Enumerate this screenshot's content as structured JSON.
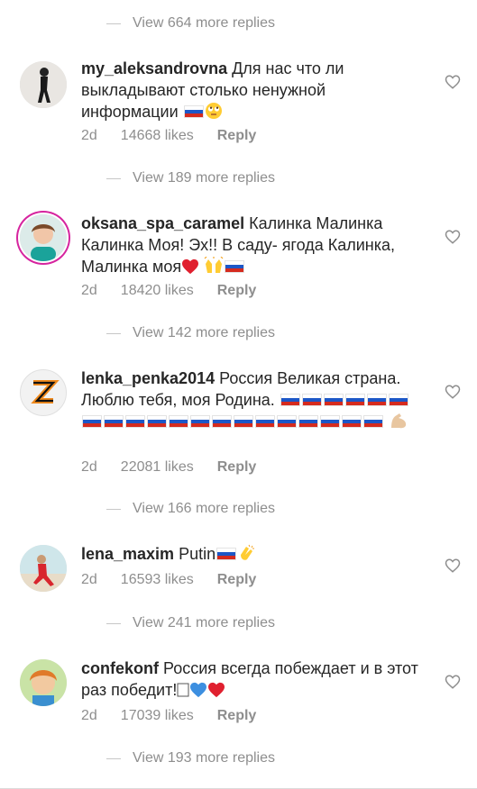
{
  "view_more": [
    "View 664 more replies",
    "View 189 more replies",
    "View 142 more replies",
    "View 166 more replies",
    "View 241 more replies",
    "View 193 more replies"
  ],
  "comments": [
    {
      "username": "my_aleksandrovna",
      "text": "Для нас что ли выкладывают столько ненужной информации",
      "emoji": [
        "flag-russia",
        "rolling-eyes"
      ],
      "age": "2d",
      "likes": "14668 likes",
      "reply": "Reply"
    },
    {
      "username": "oksana_spa_caramel",
      "text": "Калинка Малинка Калинка Моя! Эх!! В саду- ягода Калинка, Малинка моя",
      "emoji": [
        "red-heart",
        "raising-hands",
        "flag-russia"
      ],
      "age": "2d",
      "likes": "18420 likes",
      "reply": "Reply"
    },
    {
      "username": "lenka_penka2014",
      "text": "Россия Великая страна. Люблю тебя, моя Родина.",
      "emoji": [
        "flag-russia x20",
        "flexed-biceps"
      ],
      "age": "2d",
      "likes": "22081 likes",
      "reply": "Reply"
    },
    {
      "username": "lena_maxim",
      "text": "Putin",
      "emoji": [
        "flag-russia",
        "clapping-hands"
      ],
      "age": "2d",
      "likes": "16593 likes",
      "reply": "Reply"
    },
    {
      "username": "confekonf",
      "text": "Россия всегда побеждает и в этот раз победит!",
      "emoji": [
        "white-heart",
        "blue-heart",
        "red-heart"
      ],
      "age": "2d",
      "likes": "17039 likes",
      "reply": "Reply"
    }
  ],
  "colors": {
    "meta": "#8e8e8e",
    "text": "#262626",
    "ring": "#d6249f"
  }
}
